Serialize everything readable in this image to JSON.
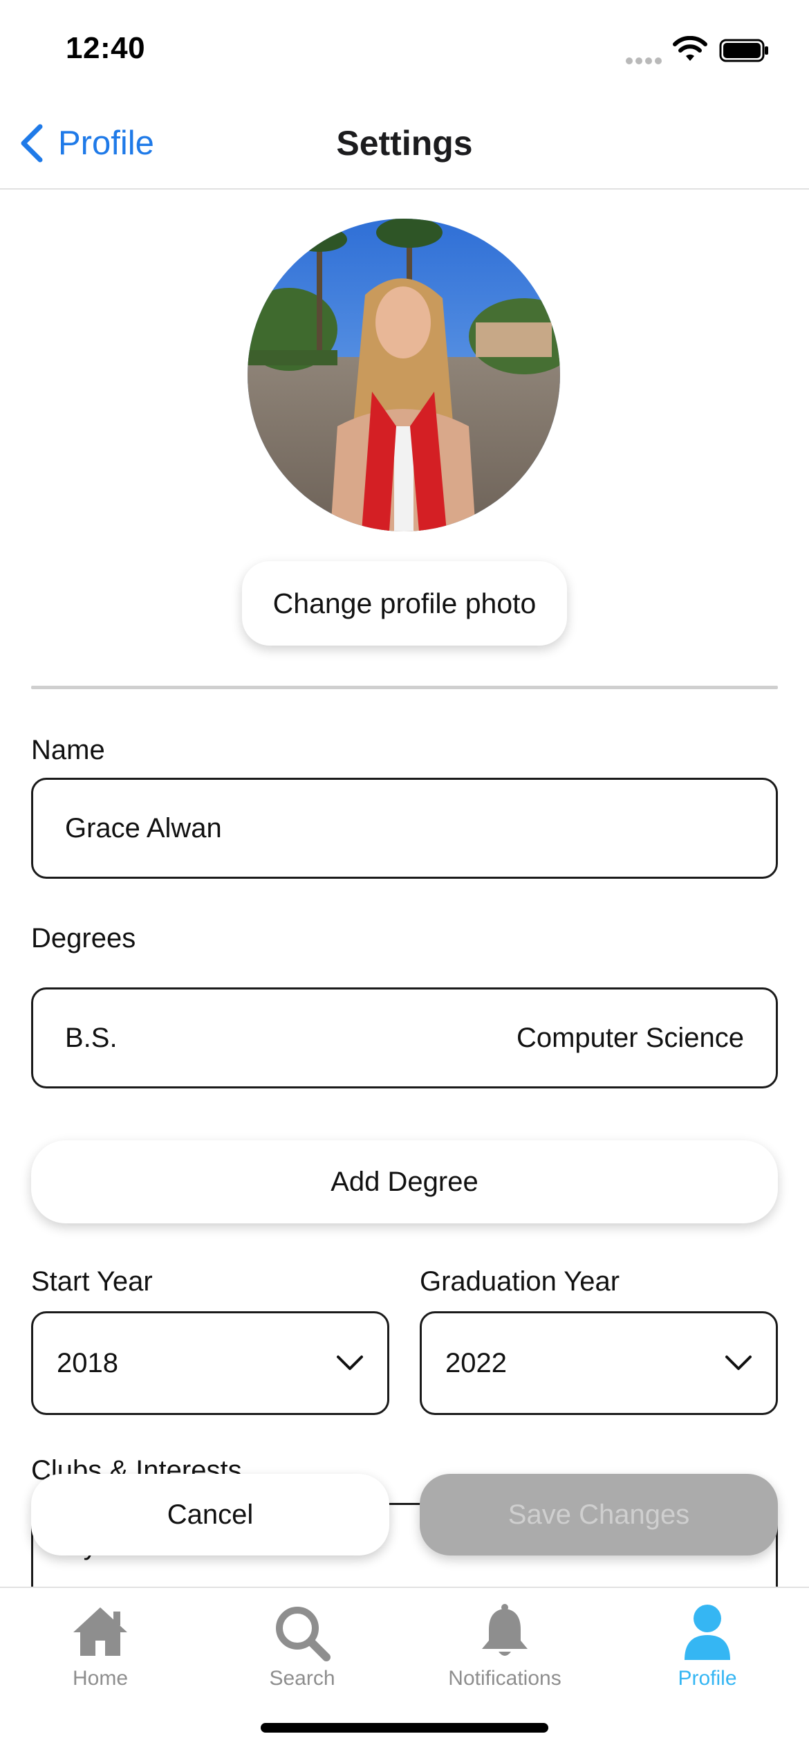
{
  "status_bar": {
    "time": "12:40"
  },
  "nav": {
    "back_label": "Profile",
    "title": "Settings"
  },
  "profile_photo": {
    "change_label": "Change profile photo"
  },
  "form": {
    "name_label": "Name",
    "name_value": "Grace Alwan",
    "degrees_label": "Degrees",
    "degree_type": "B.S.",
    "degree_major": "Computer Science",
    "add_degree_label": "Add Degree",
    "start_year_label": "Start Year",
    "start_year_value": "2018",
    "grad_year_label": "Graduation Year",
    "grad_year_value": "2022",
    "clubs_label": "Clubs & Interests",
    "clubs_first_value": "Synchro"
  },
  "actions": {
    "cancel_label": "Cancel",
    "save_label": "Save Changes"
  },
  "tabs": [
    {
      "label": "Home",
      "icon": "home-icon",
      "active": false
    },
    {
      "label": "Search",
      "icon": "search-icon",
      "active": false
    },
    {
      "label": "Notifications",
      "icon": "bell-icon",
      "active": false
    },
    {
      "label": "Profile",
      "icon": "person-icon",
      "active": true
    }
  ],
  "colors": {
    "accent": "#1f7ae8",
    "tab_active": "#35b6f3",
    "tab_inactive": "#8e8e8e",
    "save_disabled": "#ababab"
  }
}
